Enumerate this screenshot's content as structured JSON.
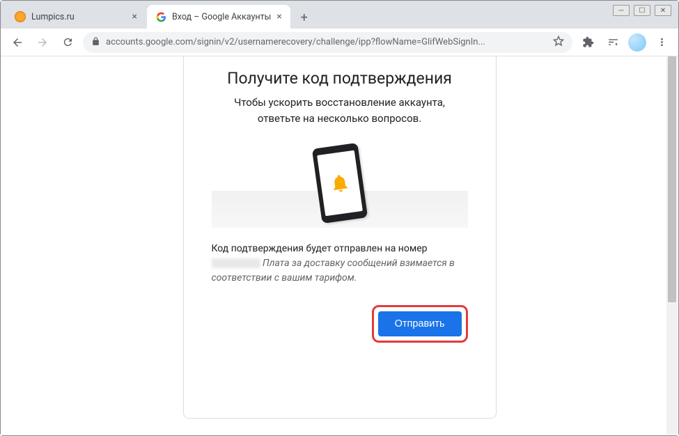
{
  "window": {
    "tabs": [
      {
        "title": "Lumpics.ru",
        "active": false
      },
      {
        "title": "Вход – Google Аккаунты",
        "active": true
      }
    ]
  },
  "toolbar": {
    "url_display": "accounts.google.com/signin/v2/usernamerecovery/challenge/ipp?flowName=GlifWebSignIn..."
  },
  "page": {
    "heading": "Получите код подтверждения",
    "subheading_line1": "Чтобы ускорить восстановление аккаунта,",
    "subheading_line2": "ответьте на несколько вопросов.",
    "info_prefix": "Код подтверждения будет отправлен на номер",
    "info_suffix": "Плата за доставку сообщений взимается в соответствии с вашим тарифом.",
    "submit_label": "Отправить"
  }
}
